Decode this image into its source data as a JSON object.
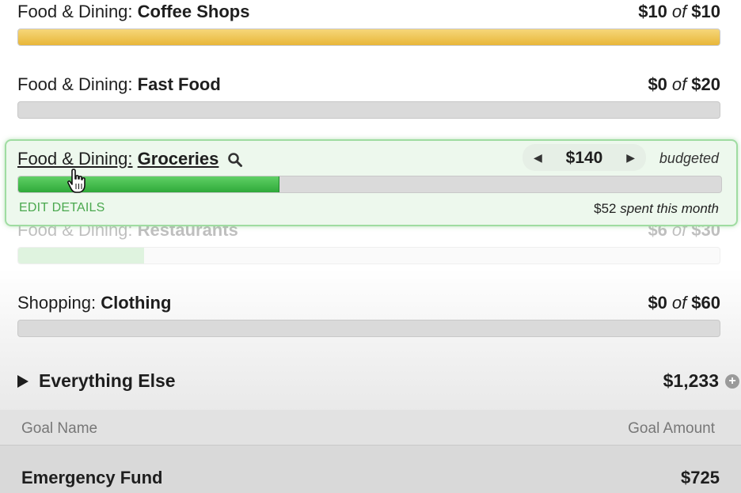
{
  "budget_items": [
    {
      "group": "Food & Dining:",
      "name": "Coffee Shops",
      "spent": "$10",
      "of": "of",
      "budget": "$10",
      "progress": 1.0
    },
    {
      "group": "Food & Dining:",
      "name": "Fast Food",
      "spent": "$0",
      "of": "of",
      "budget": "$20",
      "progress": 0.0
    },
    {
      "group": "Food & Dining:",
      "name": "Groceries",
      "progress": 0.37,
      "stepper_value": "$140",
      "stepper_prev": "◀",
      "stepper_next": "▶",
      "budgeted_label": "budgeted",
      "edit_label": "EDIT DETAILS",
      "spent_amount": "$52",
      "spent_label": "spent this month"
    },
    {
      "group": "Food & Dining:",
      "name": "Restaurants",
      "spent": "$6",
      "of": "of",
      "budget": "$30",
      "progress": 0.18
    },
    {
      "group": "Shopping:",
      "name": "Clothing",
      "spent": "$0",
      "of": "of",
      "budget": "$60",
      "progress": 0.0
    }
  ],
  "everything_else": {
    "title": "Everything Else",
    "amount": "$1,233",
    "plus": "+"
  },
  "goals": {
    "col_name": "Goal Name",
    "col_amount": "Goal Amount",
    "rows": [
      {
        "name": "Emergency Fund",
        "amount": "$725"
      }
    ]
  },
  "colors": {
    "yellow": "#e8b638",
    "green": "#2fa93a",
    "edit": "#4aa84e"
  },
  "icons": [
    "magnifier-icon",
    "hand-cursor-icon",
    "expand-triangle-icon",
    "plus-circle-icon"
  ]
}
